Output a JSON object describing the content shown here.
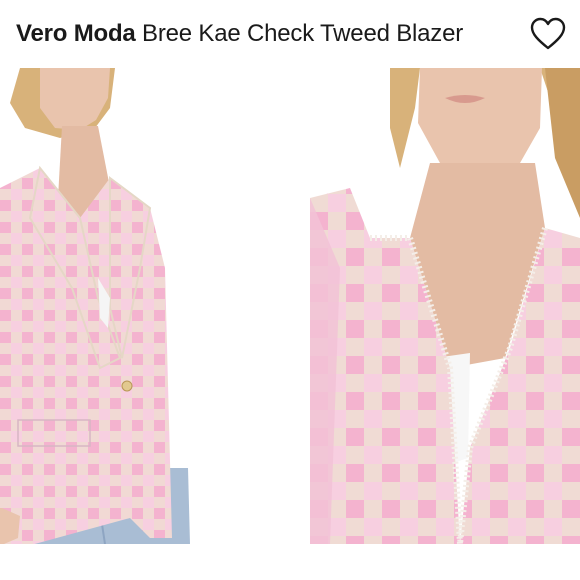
{
  "header": {
    "brand": "Vero Moda",
    "product_name": "Bree Kae Check Tweed Blazer",
    "favorite_icon": "heart-outline-icon"
  },
  "gallery": {
    "images": [
      {
        "view": "front-full",
        "icon": "product-photo"
      },
      {
        "view": "close-up",
        "icon": "product-photo"
      }
    ]
  },
  "colors": {
    "blazer_pink": "#f4b3cf",
    "blazer_cream": "#eae6c8",
    "jeans_blue": "#a9bdd4",
    "skin": "#e9c4ad",
    "hair": "#d8b27a",
    "background": "#ffffff"
  }
}
